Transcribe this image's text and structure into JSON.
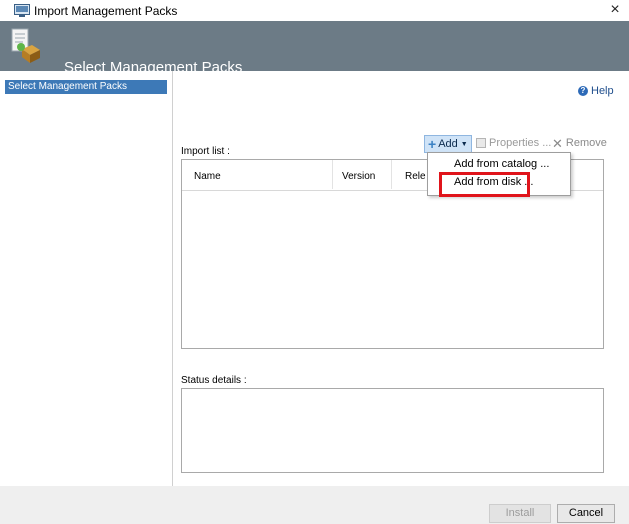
{
  "window": {
    "title": "Import Management Packs",
    "close_glyph": "×"
  },
  "header": {
    "title": "Select Management Packs"
  },
  "sidebar": {
    "items": [
      {
        "label": "Select Management Packs",
        "selected": true
      }
    ]
  },
  "help": {
    "label": "Help",
    "icon_glyph": "?"
  },
  "import_list": {
    "label": "Import list :",
    "columns": [
      "Name",
      "Version",
      "Rele"
    ],
    "rows": []
  },
  "toolbar": {
    "add_label": "Add",
    "properties_label": "Properties ...",
    "remove_label": "Remove"
  },
  "add_menu": {
    "items": [
      "Add from catalog ...",
      "Add from disk ..."
    ],
    "highlighted_item": "Add from disk ..."
  },
  "status": {
    "label": "Status details :",
    "value": ""
  },
  "footer": {
    "install_label": "Install",
    "cancel_label": "Cancel",
    "install_enabled": false
  },
  "colors": {
    "header_band": "#6c7b86",
    "selection": "#3d79b7",
    "highlight_box": "#e0141b"
  }
}
